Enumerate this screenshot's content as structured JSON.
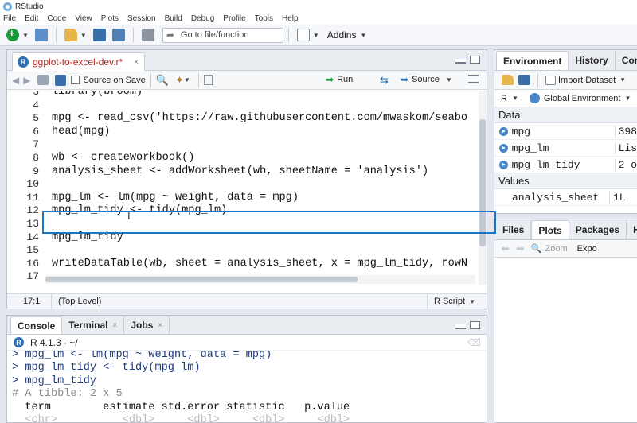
{
  "window": {
    "title": "RStudio"
  },
  "menu": [
    "File",
    "Edit",
    "Code",
    "View",
    "Plots",
    "Session",
    "Build",
    "Debug",
    "Profile",
    "Tools",
    "Help"
  ],
  "toolbar": {
    "goto_placeholder": "Go to file/function",
    "addins_label": "Addins"
  },
  "editor": {
    "tab_label": "ggplot-to-excel-dev.r*",
    "tab_close": "×",
    "source_on_save": "Source on Save",
    "run_label": "Run",
    "source_label": "Source",
    "lines": [
      {
        "n": "3",
        "code": "library(broom)"
      },
      {
        "n": "4",
        "code": ""
      },
      {
        "n": "5",
        "code": "mpg <- read_csv('https://raw.githubusercontent.com/mwaskom/seabo"
      },
      {
        "n": "6",
        "code": "head(mpg)"
      },
      {
        "n": "7",
        "code": ""
      },
      {
        "n": "8",
        "code": "wb <- createWorkbook()"
      },
      {
        "n": "9",
        "code": "analysis_sheet <- addWorksheet(wb, sheetName = 'analysis')"
      },
      {
        "n": "10",
        "code": ""
      },
      {
        "n": "11",
        "code": "mpg_lm <- lm(mpg ~ weight, data = mpg)"
      },
      {
        "n": "12",
        "code": "mpg_lm_tidy <- tidy(mpg_lm)"
      },
      {
        "n": "13",
        "code": ""
      },
      {
        "n": "14",
        "code": "mpg_lm_tidy"
      },
      {
        "n": "15",
        "code": ""
      },
      {
        "n": "16",
        "code": "writeDataTable(wb, sheet = analysis_sheet, x = mpg_lm_tidy, rowN"
      },
      {
        "n": "17",
        "code": ""
      }
    ],
    "status": {
      "position": "17:1",
      "level": "(Top Level)",
      "language": "R Script"
    }
  },
  "console": {
    "tabs": [
      {
        "label": "Console",
        "close": ""
      },
      {
        "label": "Terminal",
        "close": "×"
      },
      {
        "label": "Jobs",
        "close": "×"
      }
    ],
    "r_version": "R 4.1.3 · ~/",
    "lines": [
      {
        "text": "> mpg_lm <- lm(mpg ~ weight, data = mpg)",
        "kind": "cmd"
      },
      {
        "text": "> mpg_lm_tidy <- tidy(mpg_lm)",
        "kind": "cmd"
      },
      {
        "text": "> mpg_lm_tidy",
        "kind": "cmd"
      },
      {
        "text": "# A tibble: 2 x 5",
        "kind": "cmt"
      },
      {
        "text": "  term        estimate std.error statistic   p.value",
        "kind": "out"
      },
      {
        "text": "  <chr>          <dbl>     <dbl>     <dbl>     <dbl>",
        "kind": "faint"
      }
    ]
  },
  "environment": {
    "tabs": [
      "Environment",
      "History",
      "Conn"
    ],
    "import_label": "Import Dataset",
    "lang": "R",
    "scope": "Global Environment",
    "data_header": "Data",
    "values_header": "Values",
    "data": [
      {
        "name": "mpg",
        "value": "398"
      },
      {
        "name": "mpg_lm",
        "value": "Lis"
      },
      {
        "name": "mpg_lm_tidy",
        "value": "2 o"
      }
    ],
    "values": [
      {
        "name": "analysis_sheet",
        "value": "1L"
      }
    ]
  },
  "files_pane": {
    "tabs": [
      "Files",
      "Plots",
      "Packages",
      "He"
    ],
    "zoom_label": "Zoom",
    "export_label": "Expo"
  }
}
